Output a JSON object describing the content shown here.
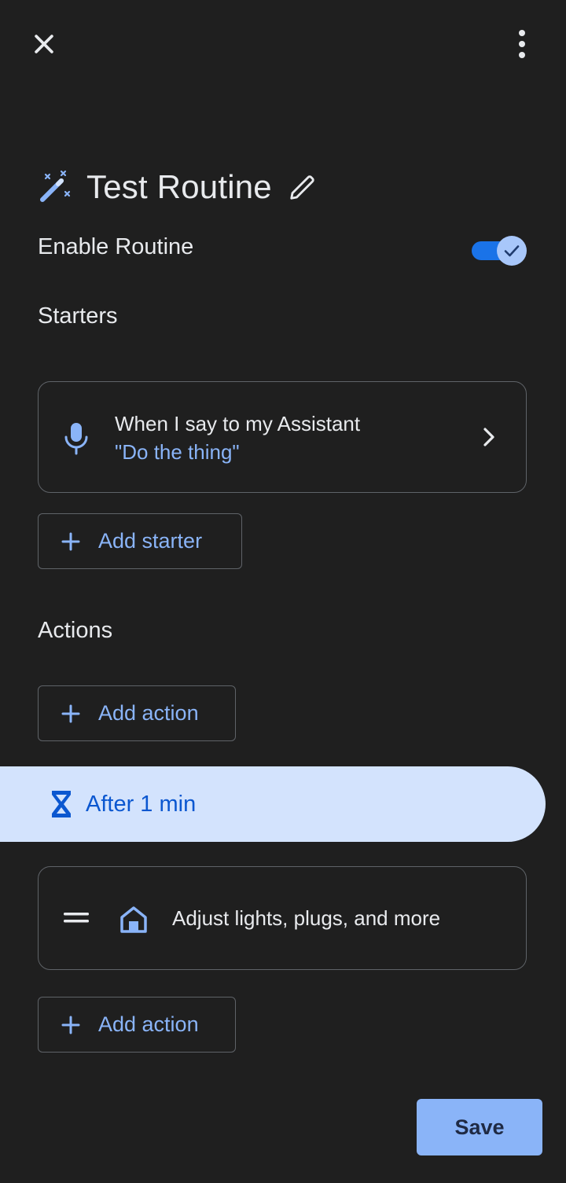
{
  "header": {
    "close_icon": "close-icon",
    "more_icon": "more-vert-icon"
  },
  "routine": {
    "title": "Test Routine",
    "title_icon": "magic-wand-icon",
    "edit_icon": "pencil-icon",
    "enable_label": "Enable Routine",
    "enabled": true
  },
  "starters": {
    "heading": "Starters",
    "items": [
      {
        "icon": "mic-icon",
        "title": "When I say to my Assistant",
        "subtitle": "\"Do the thing\""
      }
    ],
    "add_label": "Add starter"
  },
  "actions": {
    "heading": "Actions",
    "add_label_top": "Add action",
    "delay": {
      "icon": "hourglass-icon",
      "label": "After 1 min"
    },
    "items": [
      {
        "icon": "home-icon",
        "label": "Adjust lights, plugs, and more"
      }
    ],
    "add_label_bottom": "Add action"
  },
  "footer": {
    "save_label": "Save"
  },
  "colors": {
    "background": "#1f1f1f",
    "accent": "#8ab4f8",
    "toggle_track": "#1a73e8",
    "delay_pill": "#d3e3fd",
    "border": "#5f6368"
  }
}
